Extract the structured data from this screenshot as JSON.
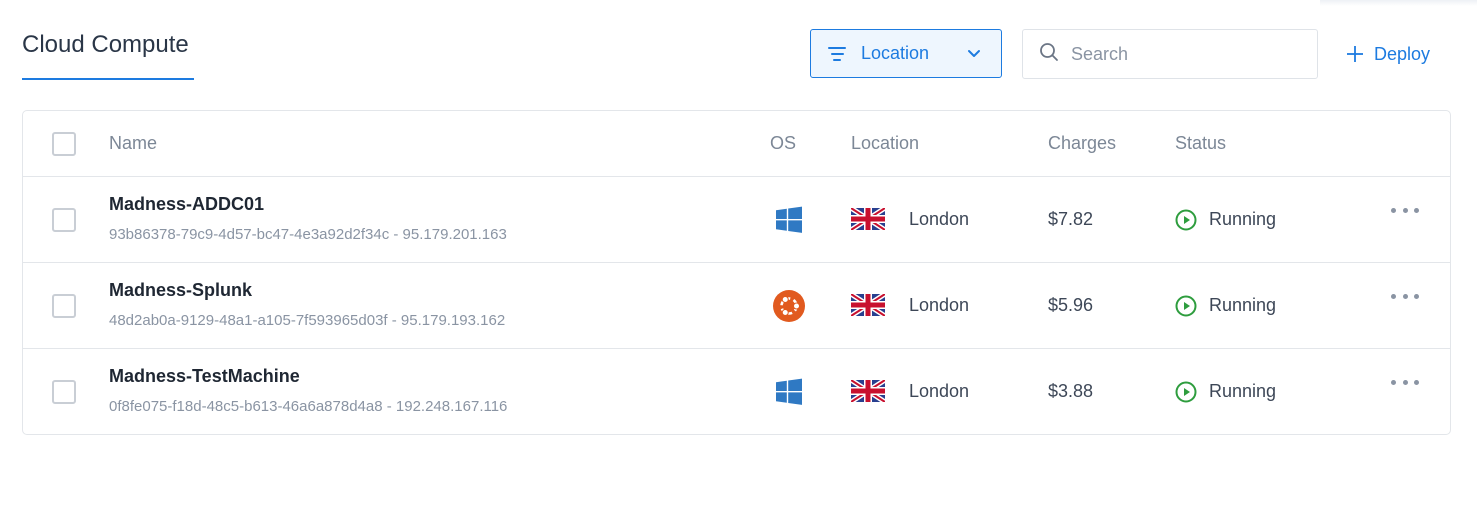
{
  "page": {
    "title": "Cloud Compute"
  },
  "toolbar": {
    "location_filter_label": "Location",
    "search_placeholder": "Search",
    "deploy_label": "Deploy"
  },
  "table": {
    "columns": {
      "name": "Name",
      "os": "OS",
      "location": "Location",
      "charges": "Charges",
      "status": "Status"
    },
    "rows": [
      {
        "name": "Madness-ADDC01",
        "details": "93b86378-79c9-4d57-bc47-4e3a92d2f34c - 95.179.201.163",
        "os_icon": "windows-icon",
        "flag_icon": "uk-flag-icon",
        "location": "London",
        "charges": "$7.82",
        "status": "Running"
      },
      {
        "name": "Madness-Splunk",
        "details": "48d2ab0a-9129-48a1-a105-7f593965d03f - 95.179.193.162",
        "os_icon": "ubuntu-icon",
        "flag_icon": "uk-flag-icon",
        "location": "London",
        "charges": "$5.96",
        "status": "Running"
      },
      {
        "name": "Madness-TestMachine",
        "details": "0f8fe075-f18d-48c5-b613-46a6a878d4a8 - 192.248.167.116",
        "os_icon": "windows-icon",
        "flag_icon": "uk-flag-icon",
        "location": "London",
        "charges": "$3.88",
        "status": "Running"
      }
    ]
  },
  "colors": {
    "accent": "#1d7be0",
    "running": "#2e9d3e",
    "windows": "#2f79c3",
    "ubuntu": "#e15a1f"
  }
}
